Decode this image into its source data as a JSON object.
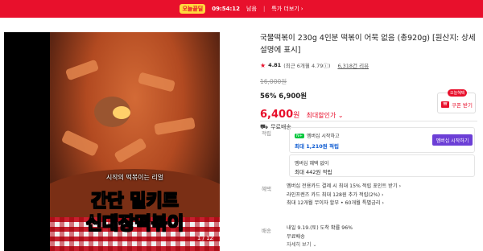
{
  "topbar": {
    "badge": "오늘끝딜",
    "timer": "09:54:12",
    "timer_suffix": "남음",
    "separator": "|",
    "more_label": "특가 더보기",
    "more_icon": "chevron-right-icon",
    "bg_color": "#e8102c"
  },
  "media": {
    "caption_small": "시작의 떡볶이는 리얼",
    "caption_line1": "간단 밀키트",
    "caption_line2": "신대장떡볶이",
    "counter": "1 / 12"
  },
  "product": {
    "title": "국물떡볶이 230g 4인분 떡볶이 어묵 없음 (총920g) [원산지: 상세설명에 표시]",
    "rating": "4.81",
    "rating_detail": "(최근 6개월 4.79ⓘ)",
    "reviews": "6,318건 리뷰",
    "original_price": "16,000원",
    "discount_label": "56% 6,900원",
    "final_price": "6,400",
    "final_won": "원",
    "max_discount_label": "최대할인가 ⌄",
    "shipping": "무료배송",
    "accent_color": "#e8102c"
  },
  "coupon": {
    "tag": "오늘혜택",
    "label": "쿠폰 받기",
    "icon": "coupon-icon"
  },
  "points": {
    "label": "적립",
    "membership_badge": "N+",
    "membership_text": "멤버십 시작하고",
    "membership_points": "최대 1,210원 적립",
    "membership_button": "멤버십 시작하기",
    "non_member_title": "멤버십 혜택 없이",
    "non_member_points": "최대 442원 적립"
  },
  "benefits": {
    "label": "혜택",
    "line1": "멤버십 전용카드 결제 시 최대 15% 적립 포인트 받기 ›",
    "line2": "라인프렌즈 카드 최대 128원 추가 적립(2%) ›",
    "line3": "최대 12개월 무이자 할부 • 60개월 특별금리 ›"
  },
  "delivery": {
    "label": "배송",
    "line1": "내일 9.19.(토) 도착 확률 96%",
    "line2": "무료배송",
    "more": "자세히 보기 ⌄"
  }
}
